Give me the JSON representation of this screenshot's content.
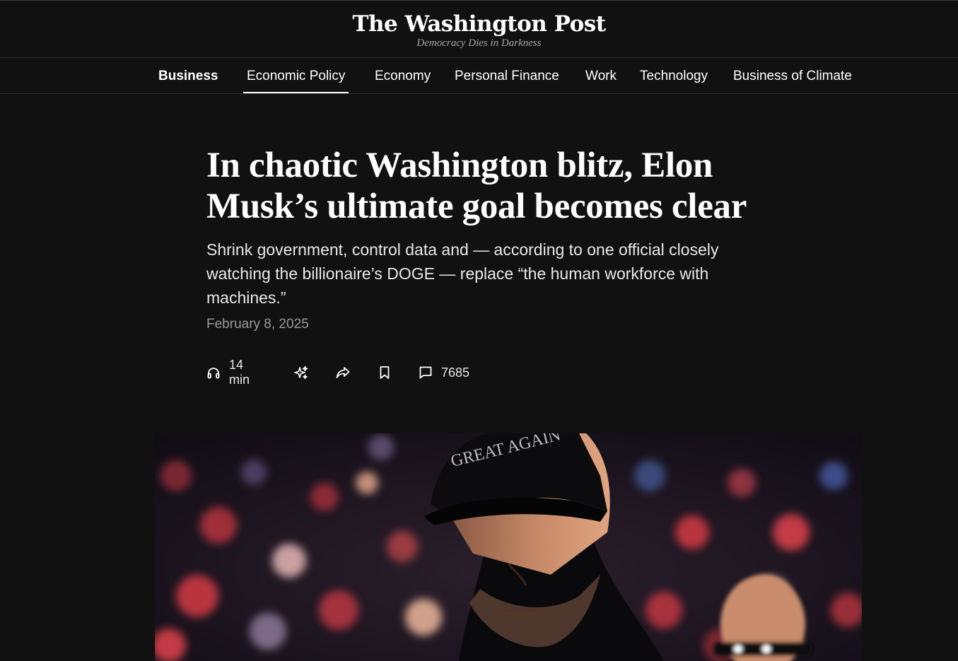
{
  "masthead": {
    "title": "The Washington Post",
    "tagline": "Democracy Dies in Darkness"
  },
  "nav": {
    "section": "Business",
    "items": [
      {
        "label": "Economic Policy",
        "active": true
      },
      {
        "label": "Economy"
      },
      {
        "label": "Personal Finance"
      },
      {
        "label": "Work"
      },
      {
        "label": "Technology"
      },
      {
        "label": "Business of Climate"
      }
    ]
  },
  "article": {
    "headline": "In chaotic Washington blitz, Elon Musk’s ultimate goal becomes clear",
    "dek": "Shrink government, control data and — according to one official closely watching the billionaire’s DOGE — replace “the human workforce with machines.”",
    "date": "February 8, 2025"
  },
  "actions": {
    "listen": {
      "icon": "headphones-icon",
      "label": "14 min"
    },
    "summarize": {
      "icon": "sparkle-icon"
    },
    "share": {
      "icon": "share-icon"
    },
    "save": {
      "icon": "bookmark-icon"
    },
    "comments": {
      "icon": "comment-icon",
      "count": "7685"
    }
  },
  "hero_image": {
    "cap_text": "GREAT AGAIN"
  }
}
